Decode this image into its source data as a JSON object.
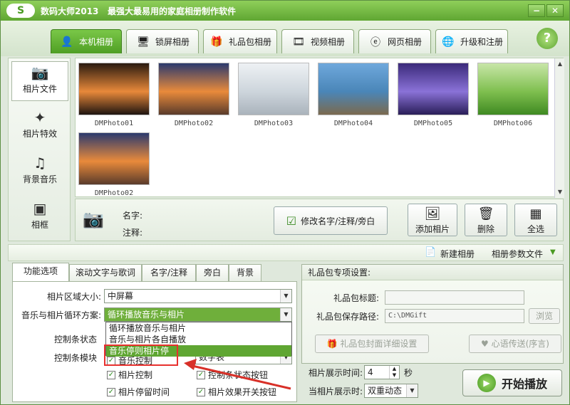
{
  "app": {
    "logo": "S",
    "name": "数码大师2013",
    "slogan": "最强大最易用的家庭相册制作软件",
    "minimize": "−",
    "close": "✕"
  },
  "tabs": [
    {
      "label": "本机相册",
      "icon": "user-photo-icon",
      "active": true
    },
    {
      "label": "锁屏相册",
      "icon": "monitor-icon",
      "active": false
    },
    {
      "label": "礼品包相册",
      "icon": "gift-icon",
      "active": false
    },
    {
      "label": "视频相册",
      "icon": "film-icon",
      "active": false
    },
    {
      "label": "网页相册",
      "icon": "web-icon",
      "active": false
    },
    {
      "label": "升级和注册",
      "icon": "globe-icon",
      "active": false
    }
  ],
  "help": "?",
  "sidebar": [
    {
      "label": "相片文件",
      "icon": "camera-icon",
      "active": true
    },
    {
      "label": "相片特效",
      "icon": "sparkle-icon",
      "active": false
    },
    {
      "label": "背景音乐",
      "icon": "music-note-icon",
      "active": false
    },
    {
      "label": "相框",
      "icon": "frame-icon",
      "active": false
    }
  ],
  "photos": [
    {
      "caption": "DMPhoto01",
      "colors": [
        "#2a1b10",
        "#e8893a",
        "#1e1410"
      ]
    },
    {
      "caption": "DMPhoto02",
      "colors": [
        "#2b3a6e",
        "#e98a3b",
        "#5a3b2b"
      ]
    },
    {
      "caption": "DMPhoto03",
      "colors": [
        "#eef1f4",
        "#cdd5dc",
        "#aab3bc"
      ]
    },
    {
      "caption": "DMPhoto04",
      "colors": [
        "#6fa8dc",
        "#4a86b8",
        "#7b6a4e"
      ]
    },
    {
      "caption": "DMPhoto05",
      "colors": [
        "#3b2a7a",
        "#8a72d8",
        "#2a1e58"
      ]
    },
    {
      "caption": "DMPhoto06",
      "colors": [
        "#c8e6a8",
        "#7fbf4f",
        "#3f8a22"
      ]
    },
    {
      "caption": "DMPhoto02",
      "colors": [
        "#2b3a6e",
        "#e98a3b",
        "#5a3b2b"
      ]
    }
  ],
  "info": {
    "name_label": "名字:",
    "note_label": "注释:"
  },
  "buttons": {
    "edit": "修改名字/注释/旁白",
    "add": "添加相片",
    "delete": "删除",
    "select_all": "全选"
  },
  "midbar": {
    "new_album": "新建相册",
    "album_params": "相册参数文件"
  },
  "lower_tabs": [
    {
      "label": "功能选项",
      "active": true
    },
    {
      "label": "滚动文字与歌词",
      "active": false
    },
    {
      "label": "名字/注释",
      "active": false
    },
    {
      "label": "旁白",
      "active": false
    },
    {
      "label": "背景",
      "active": false
    }
  ],
  "options": {
    "area_label": "相片区域大小:",
    "area_value": "中屏幕",
    "loop_label": "音乐与相片循环方案:",
    "loop_value": "循环播放音乐与相片",
    "dropdown_options": [
      "循环播放音乐与相片",
      "音乐与相片各自播放",
      "音乐停则相片停"
    ],
    "ctrl_state_label": "控制条状态",
    "ctrl_module_label": "控制条模块",
    "hidden_select": "数字表",
    "checks": [
      {
        "label": "音乐控制",
        "checked": true
      },
      {
        "label": "相片控制",
        "checked": true
      },
      {
        "label": "控制条状态按钮",
        "checked": true
      },
      {
        "label": "相片停留时间",
        "checked": true
      },
      {
        "label": "相片效果开关按钮",
        "checked": true
      }
    ]
  },
  "gift": {
    "title": "礼品包专项设置:",
    "title_label": "礼品包标题:",
    "path_label": "礼品包保存路径:",
    "path_value": "C:\\DMGift",
    "browse": "浏览",
    "cover": "礼品包封面详细设置",
    "message": "心语传送(序言)"
  },
  "display": {
    "time_label": "相片展示时间:",
    "time_value": "4",
    "unit": "秒",
    "effect_label": "当相片展示时:",
    "effect_value": "双重动态"
  },
  "play": "开始播放"
}
